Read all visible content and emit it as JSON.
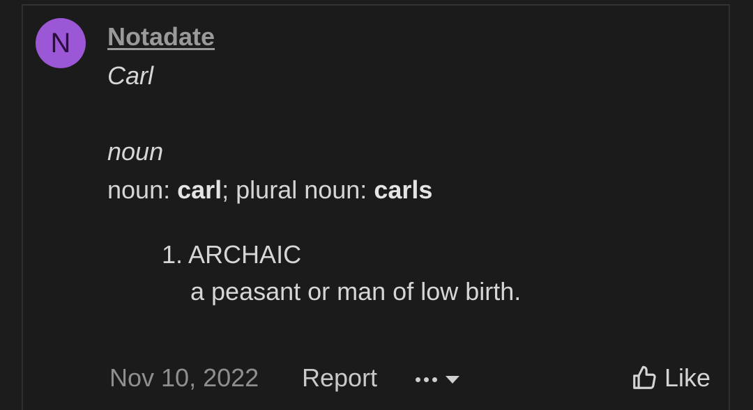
{
  "comment": {
    "avatar_letter": "N",
    "avatar_color": "#9b57d6",
    "username": "Notadate",
    "word": "Carl",
    "part_of_speech": "noun",
    "forms": {
      "prefix": "noun: ",
      "singular": "carl",
      "middle": "; plural noun: ",
      "plural": "carls"
    },
    "definition": {
      "number": "1.",
      "register": "ARCHAIC",
      "text": "a peasant or man of low birth."
    }
  },
  "footer": {
    "date": "Nov 10, 2022",
    "report_label": "Report",
    "more_icon": "ellipsis-icon",
    "dropdown_icon": "caret-down-icon",
    "like_icon": "thumbs-up-icon",
    "like_label": "Like"
  }
}
